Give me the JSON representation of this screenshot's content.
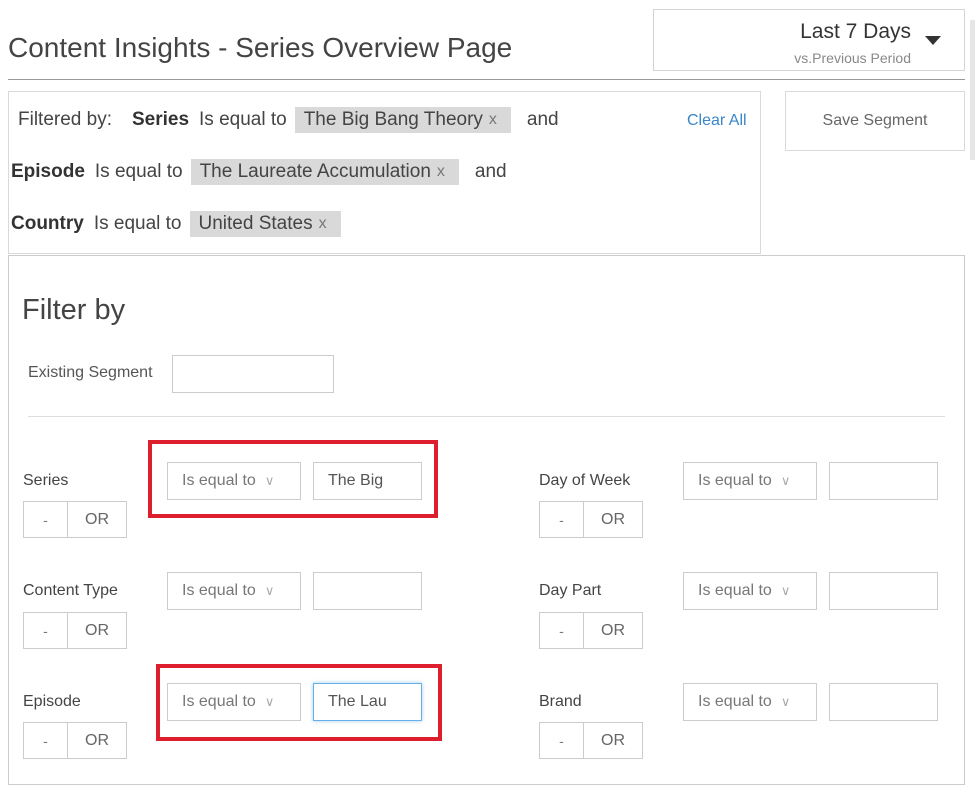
{
  "header": {
    "title": "Content Insights - Series Overview Page",
    "date_range": "Last 7 Days",
    "comparison": "vs.Previous Period"
  },
  "summary": {
    "lead": "Filtered by:",
    "clear_all": "Clear All",
    "save_segment": "Save Segment",
    "filters": [
      {
        "name": "Series",
        "operator": "Is equal to",
        "value": "The Big Bang Theory",
        "remove": "x",
        "joiner": "and"
      },
      {
        "name": "Episode",
        "operator": "Is equal to",
        "value": "The Laureate Accumulation",
        "remove": "x",
        "joiner": "and"
      },
      {
        "name": "Country",
        "operator": "Is equal to",
        "value": "United States",
        "remove": "x",
        "joiner": ""
      }
    ]
  },
  "panel": {
    "title": "Filter by",
    "existing_segment_label": "Existing Segment",
    "existing_segment_value": "",
    "minus_label": "-",
    "or_label": "OR",
    "chevron": "∨",
    "rows": [
      {
        "label": "Series",
        "operator": "Is equal to",
        "value": "The Big",
        "highlighted": true
      },
      {
        "label": "Day of Week",
        "operator": "Is equal to",
        "value": ""
      },
      {
        "label": "Content Type",
        "operator": "Is equal to",
        "value": ""
      },
      {
        "label": "Day Part",
        "operator": "Is equal to",
        "value": ""
      },
      {
        "label": "Episode",
        "operator": "Is equal to",
        "value": "The Lau",
        "highlighted": true,
        "focused": true
      },
      {
        "label": "Brand",
        "operator": "Is equal to",
        "value": ""
      }
    ]
  },
  "colors": {
    "accent_link": "#3a86c8",
    "highlight": "#dd1e2c",
    "chip_bg": "#d9d9d9",
    "focus_border": "#66afe9"
  }
}
